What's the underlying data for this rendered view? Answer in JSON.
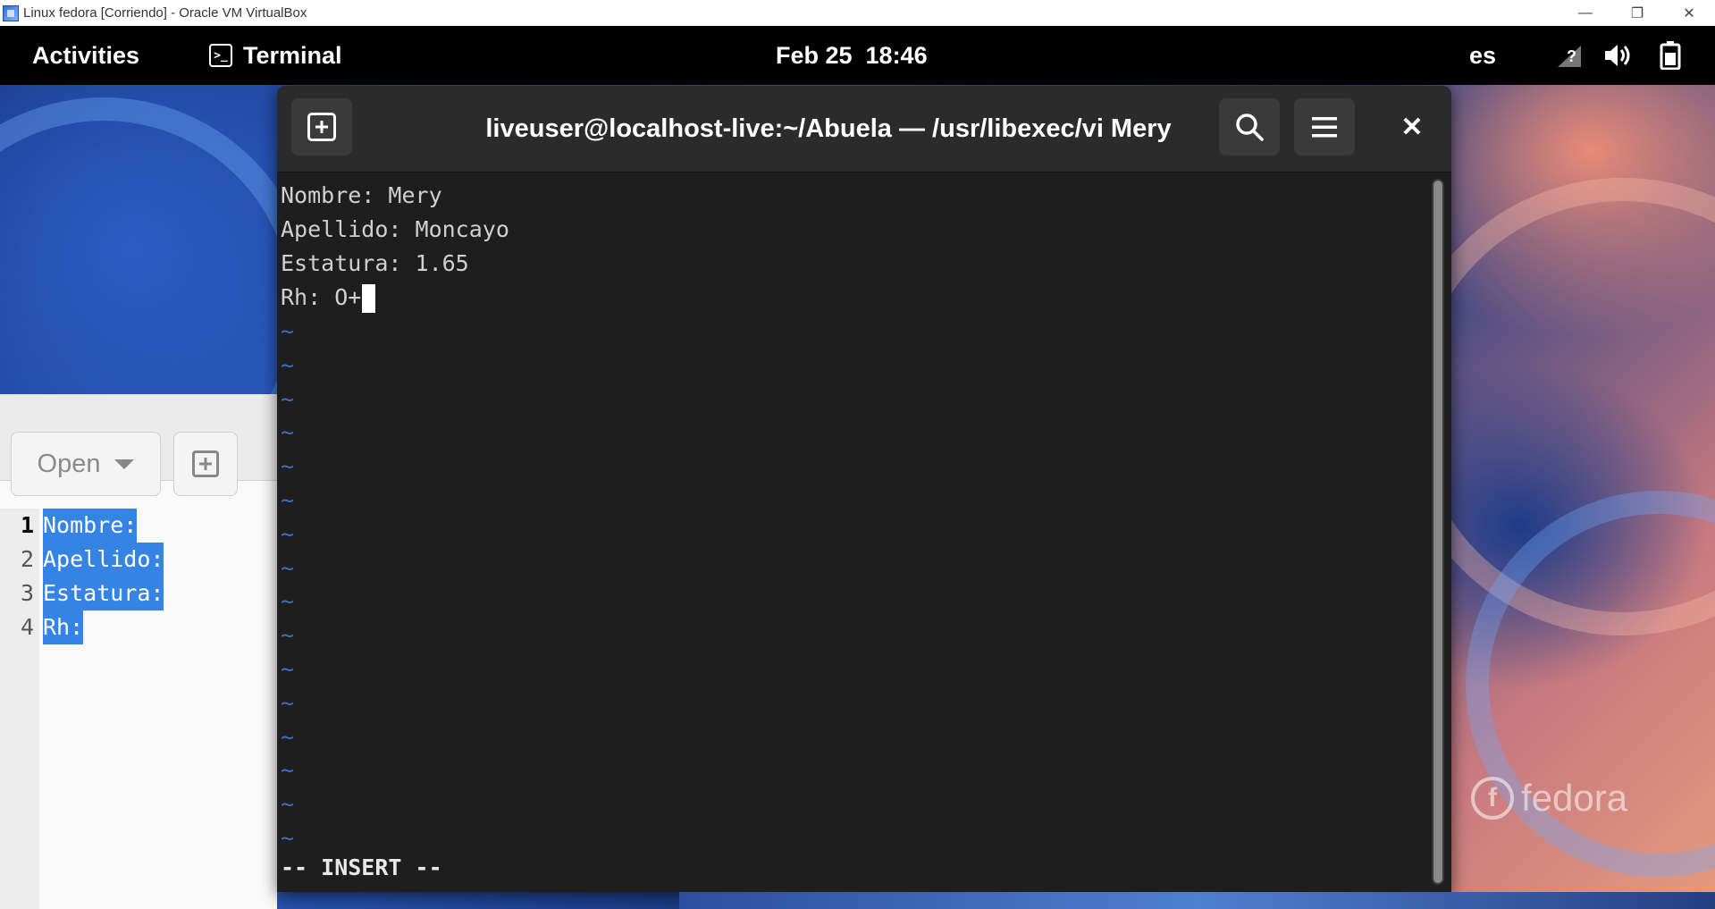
{
  "host": {
    "title": "Linux fedora [Corriendo] - Oracle VM VirtualBox",
    "controls": [
      "minimize-icon",
      "restore-icon",
      "close-icon"
    ]
  },
  "topbar": {
    "activities": "Activities",
    "app_name": "Terminal",
    "clock": "Feb 25  18:46",
    "keyboard_layout": "es",
    "icons": [
      "network-unknown-icon",
      "volume-icon",
      "battery-icon"
    ]
  },
  "gedit": {
    "open_label": "Open",
    "lines": [
      {
        "num": "1",
        "text": "Nombre:"
      },
      {
        "num": "2",
        "text": "Apellido:"
      },
      {
        "num": "3",
        "text": "Estatura:"
      },
      {
        "num": "4",
        "text": "Rh:"
      }
    ]
  },
  "terminal": {
    "title": "liveuser@localhost-live:~/Abuela — /usr/libexec/vi Mery",
    "lines": [
      "Nombre: Mery",
      "Apellido: Moncayo",
      "Estatura: 1.65",
      "Rh: O+"
    ],
    "tilde": "~",
    "tilde_count": 16,
    "mode": "-- INSERT --"
  },
  "desktop": {
    "logo_text": "fedora"
  },
  "colors": {
    "selection": "#3584e4",
    "terminal_bg": "#1e1e1e",
    "tilde": "#3b6fc9"
  }
}
